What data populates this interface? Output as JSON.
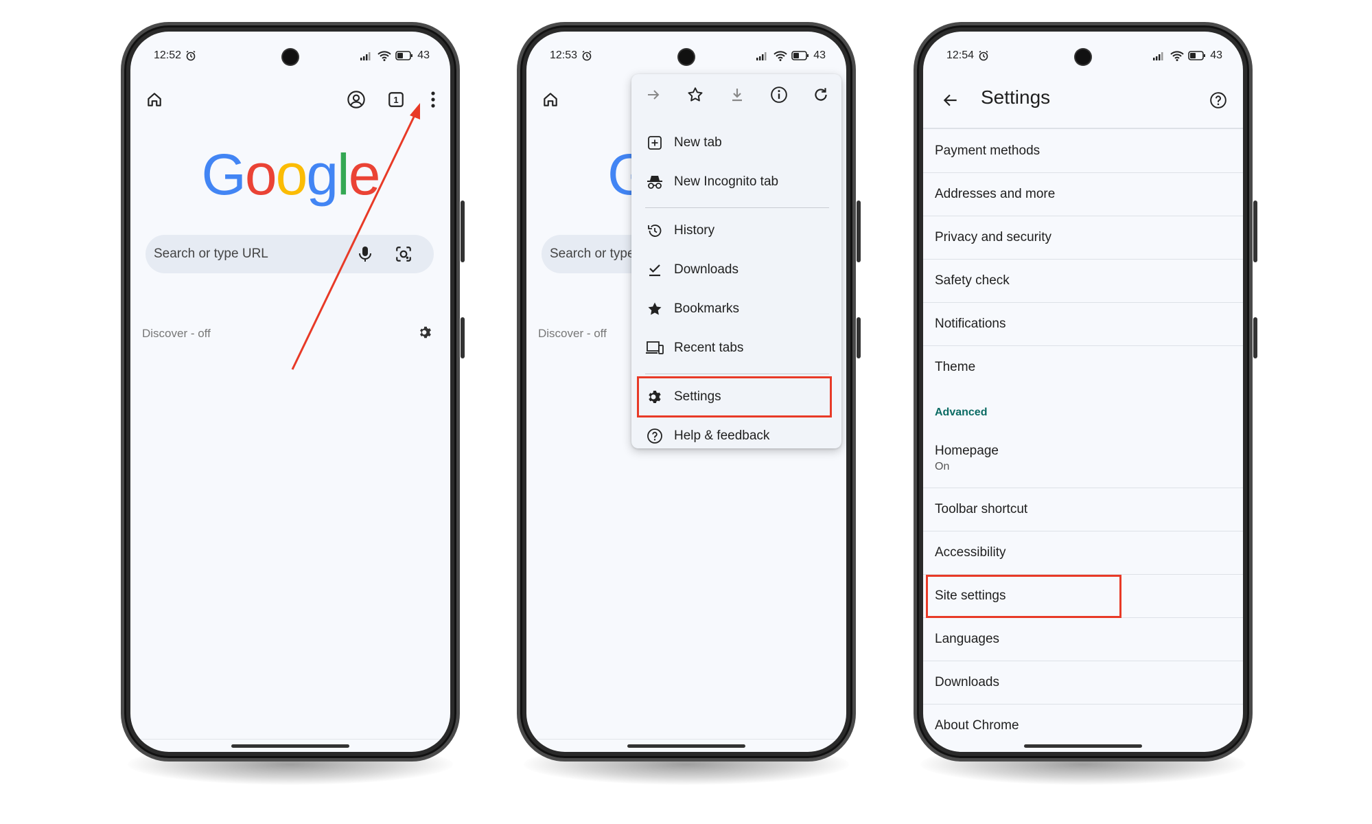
{
  "colors": {
    "highlight": "#e83a27",
    "arrow": "#e83a27",
    "advanced": "#0b6b63",
    "google_blue": "#4285F4",
    "google_red": "#EA4335",
    "google_yellow": "#FBBC05",
    "google_green": "#34A853"
  },
  "phone1": {
    "status": {
      "time": "12:52",
      "battery": "43"
    },
    "logo": [
      "G",
      "o",
      "o",
      "g",
      "l",
      "e"
    ],
    "search": {
      "placeholder": "Search or type URL"
    },
    "discover": "Discover - off",
    "tabs_count": "1"
  },
  "phone2": {
    "status": {
      "time": "12:53",
      "battery": "43"
    },
    "logo_partial": "G",
    "search": {
      "placeholder_partial": "Search or type"
    },
    "discover": "Discover - off",
    "menu": {
      "items": [
        {
          "label": "New tab",
          "icon": "plus-box-icon"
        },
        {
          "label": "New Incognito tab",
          "icon": "incognito-icon"
        },
        {
          "label": "History",
          "icon": "history-icon"
        },
        {
          "label": "Downloads",
          "icon": "download-check-icon"
        },
        {
          "label": "Bookmarks",
          "icon": "star-filled-icon"
        },
        {
          "label": "Recent tabs",
          "icon": "devices-icon"
        },
        {
          "label": "Settings",
          "icon": "gear-icon"
        },
        {
          "label": "Help & feedback",
          "icon": "help-circle-icon"
        }
      ]
    }
  },
  "phone3": {
    "status": {
      "time": "12:54",
      "battery": "43"
    },
    "title": "Settings",
    "rows": [
      {
        "label": "Payment methods"
      },
      {
        "label": "Addresses and more"
      },
      {
        "label": "Privacy and security"
      },
      {
        "label": "Safety check"
      },
      {
        "label": "Notifications"
      },
      {
        "label": "Theme"
      }
    ],
    "section_advanced": "Advanced",
    "homepage": {
      "label": "Homepage",
      "sub": "On"
    },
    "rows2": [
      {
        "label": "Toolbar shortcut"
      },
      {
        "label": "Accessibility"
      },
      {
        "label": "Site settings"
      },
      {
        "label": "Languages"
      },
      {
        "label": "Downloads"
      },
      {
        "label": "About Chrome"
      }
    ]
  }
}
